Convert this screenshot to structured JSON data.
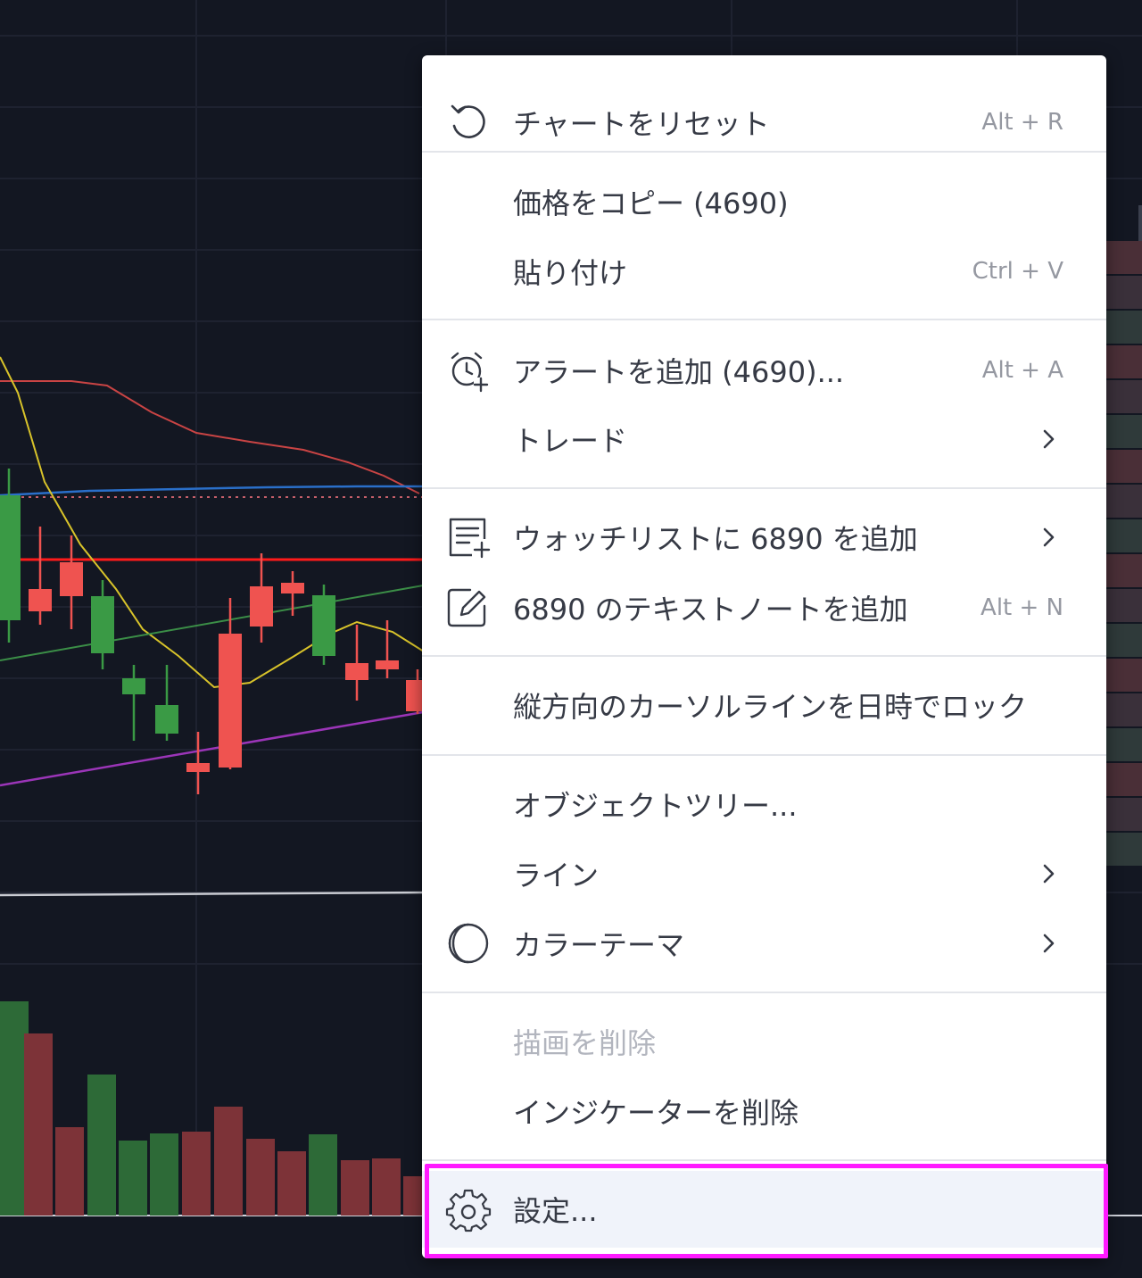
{
  "theme": {
    "bg": "#131722",
    "up": "#3a9a45",
    "down": "#ef5350",
    "accent_highlight": "#ff1aff"
  },
  "menu": {
    "items": [
      {
        "id": "reset",
        "label": "チャートをリセット",
        "shortcut": "Alt + R",
        "icon": "reset-icon"
      },
      {
        "id": "copy-price",
        "label": "価格をコピー (4690)"
      },
      {
        "id": "paste",
        "label": "貼り付け",
        "shortcut": "Ctrl + V"
      },
      {
        "id": "add-alert",
        "label": "アラートを追加 (4690)...",
        "shortcut": "Alt + A",
        "icon": "alarm-plus-icon"
      },
      {
        "id": "trade",
        "label": "トレード",
        "submenu": true
      },
      {
        "id": "add-watchlist",
        "label": "ウォッチリストに 6890 を追加",
        "submenu": true,
        "icon": "watchlist-add-icon"
      },
      {
        "id": "add-note",
        "label": "6890 のテキストノートを追加",
        "shortcut": "Alt + N",
        "icon": "note-edit-icon"
      },
      {
        "id": "lock-cursor",
        "label": "縦方向のカーソルラインを日時でロック"
      },
      {
        "id": "object-tree",
        "label": "オブジェクトツリー..."
      },
      {
        "id": "lines",
        "label": "ライン",
        "submenu": true
      },
      {
        "id": "color-theme",
        "label": "カラーテーマ",
        "submenu": true,
        "icon": "moon-icon"
      },
      {
        "id": "remove-drawings",
        "label": "描画を削除",
        "disabled": true
      },
      {
        "id": "remove-indicators",
        "label": "インジケーターを削除"
      },
      {
        "id": "settings",
        "label": "設定...",
        "icon": "gear-icon",
        "highlighted": true
      }
    ]
  }
}
